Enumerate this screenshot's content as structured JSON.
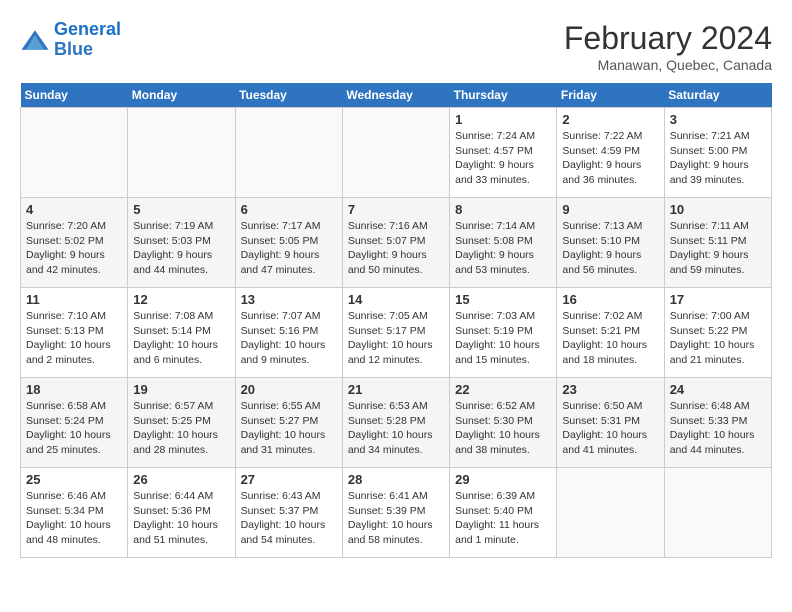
{
  "logo": {
    "line1": "General",
    "line2": "Blue"
  },
  "title": "February 2024",
  "subtitle": "Manawan, Quebec, Canada",
  "days_of_week": [
    "Sunday",
    "Monday",
    "Tuesday",
    "Wednesday",
    "Thursday",
    "Friday",
    "Saturday"
  ],
  "weeks": [
    [
      {
        "day": "",
        "sunrise": "",
        "sunset": "",
        "daylight": "",
        "empty": true
      },
      {
        "day": "",
        "sunrise": "",
        "sunset": "",
        "daylight": "",
        "empty": true
      },
      {
        "day": "",
        "sunrise": "",
        "sunset": "",
        "daylight": "",
        "empty": true
      },
      {
        "day": "",
        "sunrise": "",
        "sunset": "",
        "daylight": "",
        "empty": true
      },
      {
        "day": "1",
        "sunrise": "7:24 AM",
        "sunset": "4:57 PM",
        "daylight": "9 hours and 33 minutes."
      },
      {
        "day": "2",
        "sunrise": "7:22 AM",
        "sunset": "4:59 PM",
        "daylight": "9 hours and 36 minutes."
      },
      {
        "day": "3",
        "sunrise": "7:21 AM",
        "sunset": "5:00 PM",
        "daylight": "9 hours and 39 minutes."
      }
    ],
    [
      {
        "day": "4",
        "sunrise": "7:20 AM",
        "sunset": "5:02 PM",
        "daylight": "9 hours and 42 minutes."
      },
      {
        "day": "5",
        "sunrise": "7:19 AM",
        "sunset": "5:03 PM",
        "daylight": "9 hours and 44 minutes."
      },
      {
        "day": "6",
        "sunrise": "7:17 AM",
        "sunset": "5:05 PM",
        "daylight": "9 hours and 47 minutes."
      },
      {
        "day": "7",
        "sunrise": "7:16 AM",
        "sunset": "5:07 PM",
        "daylight": "9 hours and 50 minutes."
      },
      {
        "day": "8",
        "sunrise": "7:14 AM",
        "sunset": "5:08 PM",
        "daylight": "9 hours and 53 minutes."
      },
      {
        "day": "9",
        "sunrise": "7:13 AM",
        "sunset": "5:10 PM",
        "daylight": "9 hours and 56 minutes."
      },
      {
        "day": "10",
        "sunrise": "7:11 AM",
        "sunset": "5:11 PM",
        "daylight": "9 hours and 59 minutes."
      }
    ],
    [
      {
        "day": "11",
        "sunrise": "7:10 AM",
        "sunset": "5:13 PM",
        "daylight": "10 hours and 2 minutes."
      },
      {
        "day": "12",
        "sunrise": "7:08 AM",
        "sunset": "5:14 PM",
        "daylight": "10 hours and 6 minutes."
      },
      {
        "day": "13",
        "sunrise": "7:07 AM",
        "sunset": "5:16 PM",
        "daylight": "10 hours and 9 minutes."
      },
      {
        "day": "14",
        "sunrise": "7:05 AM",
        "sunset": "5:17 PM",
        "daylight": "10 hours and 12 minutes."
      },
      {
        "day": "15",
        "sunrise": "7:03 AM",
        "sunset": "5:19 PM",
        "daylight": "10 hours and 15 minutes."
      },
      {
        "day": "16",
        "sunrise": "7:02 AM",
        "sunset": "5:21 PM",
        "daylight": "10 hours and 18 minutes."
      },
      {
        "day": "17",
        "sunrise": "7:00 AM",
        "sunset": "5:22 PM",
        "daylight": "10 hours and 21 minutes."
      }
    ],
    [
      {
        "day": "18",
        "sunrise": "6:58 AM",
        "sunset": "5:24 PM",
        "daylight": "10 hours and 25 minutes."
      },
      {
        "day": "19",
        "sunrise": "6:57 AM",
        "sunset": "5:25 PM",
        "daylight": "10 hours and 28 minutes."
      },
      {
        "day": "20",
        "sunrise": "6:55 AM",
        "sunset": "5:27 PM",
        "daylight": "10 hours and 31 minutes."
      },
      {
        "day": "21",
        "sunrise": "6:53 AM",
        "sunset": "5:28 PM",
        "daylight": "10 hours and 34 minutes."
      },
      {
        "day": "22",
        "sunrise": "6:52 AM",
        "sunset": "5:30 PM",
        "daylight": "10 hours and 38 minutes."
      },
      {
        "day": "23",
        "sunrise": "6:50 AM",
        "sunset": "5:31 PM",
        "daylight": "10 hours and 41 minutes."
      },
      {
        "day": "24",
        "sunrise": "6:48 AM",
        "sunset": "5:33 PM",
        "daylight": "10 hours and 44 minutes."
      }
    ],
    [
      {
        "day": "25",
        "sunrise": "6:46 AM",
        "sunset": "5:34 PM",
        "daylight": "10 hours and 48 minutes."
      },
      {
        "day": "26",
        "sunrise": "6:44 AM",
        "sunset": "5:36 PM",
        "daylight": "10 hours and 51 minutes."
      },
      {
        "day": "27",
        "sunrise": "6:43 AM",
        "sunset": "5:37 PM",
        "daylight": "10 hours and 54 minutes."
      },
      {
        "day": "28",
        "sunrise": "6:41 AM",
        "sunset": "5:39 PM",
        "daylight": "10 hours and 58 minutes."
      },
      {
        "day": "29",
        "sunrise": "6:39 AM",
        "sunset": "5:40 PM",
        "daylight": "11 hours and 1 minute."
      },
      {
        "day": "",
        "sunrise": "",
        "sunset": "",
        "daylight": "",
        "empty": true
      },
      {
        "day": "",
        "sunrise": "",
        "sunset": "",
        "daylight": "",
        "empty": true
      }
    ]
  ],
  "labels": {
    "sunrise_prefix": "Sunrise: ",
    "sunset_prefix": "Sunset: ",
    "daylight_prefix": "Daylight: "
  }
}
